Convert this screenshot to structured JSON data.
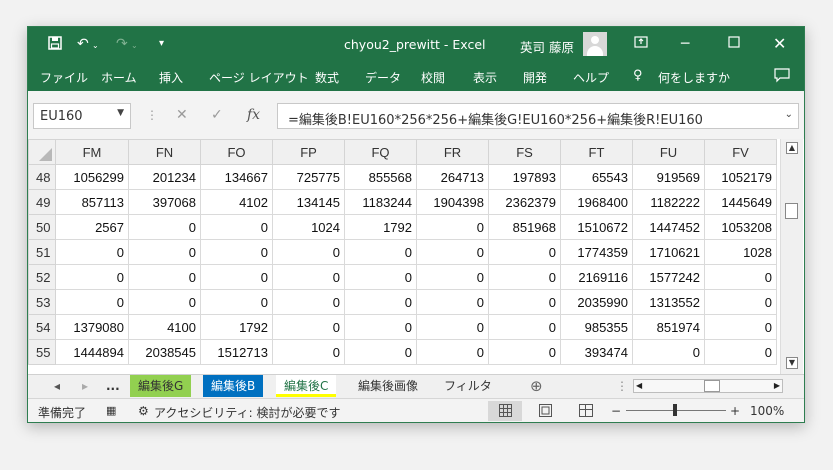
{
  "app": {
    "title": "chyou2_prewitt  -  Excel",
    "user": "英司 藤原"
  },
  "menu": [
    "ファイル",
    "ホーム",
    "挿入",
    "ページ レイアウト",
    "数式",
    "データ",
    "校閲",
    "表示",
    "開発",
    "ヘルプ",
    "何をしますか"
  ],
  "formula_bar": {
    "name_box": "EU160",
    "formula": "=編集後B!EU160*256*256+編集後G!EU160*256+編集後R!EU160",
    "icons": [
      "cancel-icon",
      "enter-icon",
      "function-icon"
    ]
  },
  "sheet": {
    "columns": [
      "FM",
      "FN",
      "FO",
      "FP",
      "FQ",
      "FR",
      "FS",
      "FT",
      "FU",
      "FV"
    ],
    "rows": [
      {
        "num": "48",
        "cells": [
          "1056299",
          "201234",
          "134667",
          "725775",
          "855568",
          "264713",
          "197893",
          "65543",
          "919569",
          "1052179"
        ]
      },
      {
        "num": "49",
        "cells": [
          "857113",
          "397068",
          "4102",
          "134145",
          "1183244",
          "1904398",
          "2362379",
          "1968400",
          "1182222",
          "1445649"
        ]
      },
      {
        "num": "50",
        "cells": [
          "2567",
          "0",
          "0",
          "1024",
          "1792",
          "0",
          "851968",
          "1510672",
          "1447452",
          "1053208"
        ]
      },
      {
        "num": "51",
        "cells": [
          "0",
          "0",
          "0",
          "0",
          "0",
          "0",
          "0",
          "1774359",
          "1710621",
          "1028"
        ]
      },
      {
        "num": "52",
        "cells": [
          "0",
          "0",
          "0",
          "0",
          "0",
          "0",
          "0",
          "2169116",
          "1577242",
          "0"
        ]
      },
      {
        "num": "53",
        "cells": [
          "0",
          "0",
          "0",
          "0",
          "0",
          "0",
          "0",
          "2035990",
          "1313552",
          "0"
        ]
      },
      {
        "num": "54",
        "cells": [
          "1379080",
          "4100",
          "1792",
          "0",
          "0",
          "0",
          "0",
          "985355",
          "851974",
          "0"
        ]
      },
      {
        "num": "55",
        "cells": [
          "1444894",
          "2038545",
          "1512713",
          "0",
          "0",
          "0",
          "0",
          "393474",
          "0",
          "0"
        ]
      }
    ]
  },
  "tabs": {
    "ellipsis": "...",
    "items": [
      {
        "label": "編集後G",
        "color": "#92d050"
      },
      {
        "label": "編集後B",
        "color": "#0070c0"
      },
      {
        "label": "編集後C",
        "color": "#ffff00",
        "active": true
      },
      {
        "label": "編集後画像",
        "color": ""
      },
      {
        "label": "フィルタ",
        "color": ""
      }
    ],
    "add_icon": "⊕"
  },
  "status": {
    "ready": "準備完了",
    "accessibility": "アクセシビリティ: 検討が必要です",
    "zoom": "100%"
  },
  "colors": {
    "excel_green": "#217346"
  }
}
